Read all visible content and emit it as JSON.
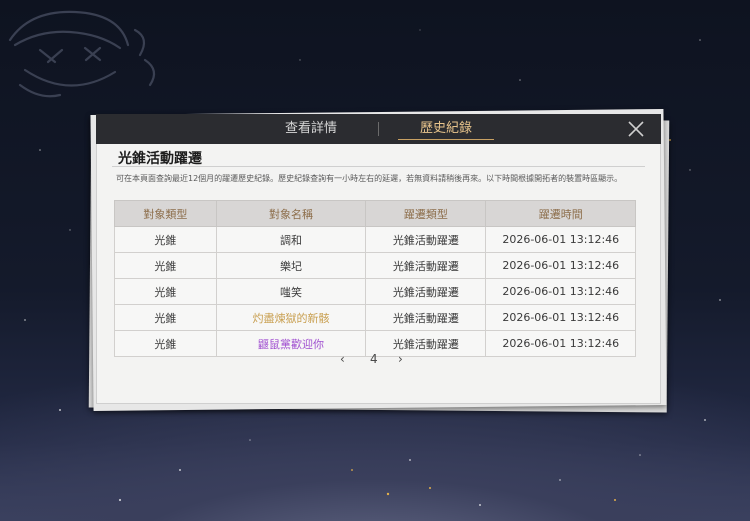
{
  "tabs": [
    {
      "label": "查看詳情",
      "active": false
    },
    {
      "label": "歷史紀錄",
      "active": true
    }
  ],
  "title": "光錐活動躍遷",
  "description": "可在本頁面查詢最近12個月的躍遷歷史紀錄。歷史紀錄查詢有一小時左右的延遲，若無資料請稍後再來。以下時間根據開拓者的裝置時區顯示。",
  "table": {
    "headers": [
      "對象類型",
      "對象名稱",
      "躍遷類型",
      "躍遷時間"
    ],
    "rows": [
      {
        "type": "光錐",
        "name": "調和",
        "warp": "光錐活動躍遷",
        "time": "2026-06-01 13:12:46",
        "rarity_color": "#3a3a3a"
      },
      {
        "type": "光錐",
        "name": "樂圮",
        "warp": "光錐活動躍遷",
        "time": "2026-06-01 13:12:46",
        "rarity_color": "#3a3a3a"
      },
      {
        "type": "光錐",
        "name": "嗤笑",
        "warp": "光錐活動躍遷",
        "time": "2026-06-01 13:12:46",
        "rarity_color": "#3a3a3a"
      },
      {
        "type": "光錐",
        "name": "灼盡煉獄的新骸",
        "warp": "光錐活動躍遷",
        "time": "2026-06-01 13:12:46",
        "rarity_color": "#c9a052"
      },
      {
        "type": "光錐",
        "name": "鼴鼠黨歡迎你",
        "warp": "光錐活動躍遷",
        "time": "2026-06-01 13:12:46",
        "rarity_color": "#a04fd0"
      }
    ]
  },
  "pager": {
    "prev": "‹",
    "page": "4",
    "next": "›"
  },
  "colors": {
    "accent": "#e8c48c",
    "header_text": "#8d6e4b",
    "tab_bar": "#2b2c30"
  }
}
